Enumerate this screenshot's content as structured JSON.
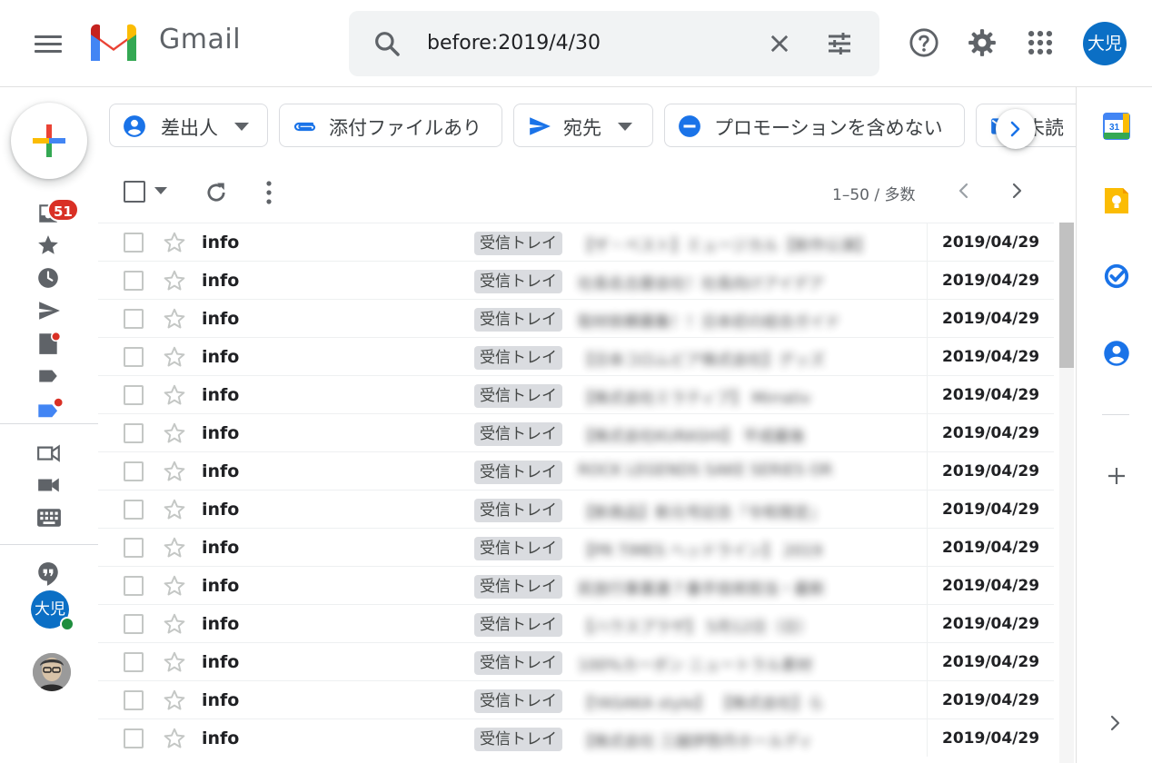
{
  "header": {
    "brand": "Gmail",
    "search_value": "before:2019/4/30",
    "avatar_text": "大児"
  },
  "sidebar": {
    "inbox_badge": "51",
    "avatar_text": "大児"
  },
  "chips": [
    {
      "label": "差出人",
      "icon": "person-circle-icon",
      "dropdown": true
    },
    {
      "label": "添付ファイルあり",
      "icon": "paperclip-icon",
      "dropdown": false
    },
    {
      "label": "宛先",
      "icon": "send-icon",
      "dropdown": true
    },
    {
      "label": "プロモーションを含めない",
      "icon": "minus-circle-icon",
      "dropdown": false
    },
    {
      "label": "未読",
      "icon": "mail-icon",
      "dropdown": false
    }
  ],
  "toolbar": {
    "range": "1–50 / 多数"
  },
  "emails": [
    {
      "sender": "info",
      "label": "受信トレイ",
      "subject": "【ザ・ベスト】ミュージカル【新作公演】",
      "date": "2019/04/29"
    },
    {
      "sender": "info",
      "label": "受信トレイ",
      "subject": "社長名古屋会社！社長向けアイデア",
      "date": "2019/04/29"
    },
    {
      "sender": "info",
      "label": "受信トレイ",
      "subject": "取材依頼募集！！日本初の総合ガイド",
      "date": "2019/04/29"
    },
    {
      "sender": "info",
      "label": "受信トレイ",
      "subject": "【日本コロムビア株式会社】グッズ",
      "date": "2019/04/29"
    },
    {
      "sender": "info",
      "label": "受信トレイ",
      "subject": "【株式会社ミラティブ】 Mirrativ",
      "date": "2019/04/29"
    },
    {
      "sender": "info",
      "label": "受信トレイ",
      "subject": "【株式会社KURASHI】 平成最後",
      "date": "2019/04/29"
    },
    {
      "sender": "info",
      "label": "受信トレイ",
      "subject": "ROCK LEGENDS SAKE SERIES OR",
      "date": "2019/04/29"
    },
    {
      "sender": "info",
      "label": "受信トレイ",
      "subject": "【新商品】新元号記念『令和限定』",
      "date": "2019/04/29"
    },
    {
      "sender": "info",
      "label": "受信トレイ",
      "subject": "【PR TIMES ヘッドライン】 2019",
      "date": "2019/04/29"
    },
    {
      "sender": "info",
      "label": "受信トレイ",
      "subject": "民放行事業連７番手技術担当・最新",
      "date": "2019/04/29"
    },
    {
      "sender": "info",
      "label": "受信トレイ",
      "subject": "【ハウスプラザ】 5月12日（日）",
      "date": "2019/04/29"
    },
    {
      "sender": "info",
      "label": "受信トレイ",
      "subject": "100%カーボン ニュートラル素材",
      "date": "2019/04/29"
    },
    {
      "sender": "info",
      "label": "受信トレイ",
      "subject": "【YASAKA style】 【株式会社】ら",
      "date": "2019/04/29"
    },
    {
      "sender": "info",
      "label": "受信トレイ",
      "subject": "【株式会社 三越伊勢丹ホールディ",
      "date": "2019/04/29"
    }
  ],
  "colors": {
    "accent_blue": "#1a73e8",
    "badge_red": "#d93025",
    "avatar_blue": "#0b6fc5",
    "online_green": "#1e8e3e"
  }
}
